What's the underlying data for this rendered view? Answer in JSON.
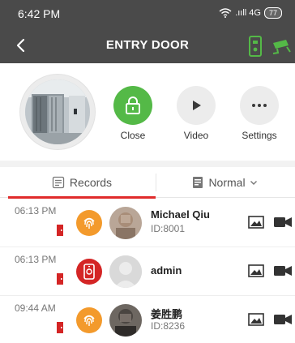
{
  "status_bar": {
    "time": "6:42 PM",
    "network": ".ııll 4G",
    "battery": "77"
  },
  "title_bar": {
    "title": "ENTRY DOOR",
    "icons": [
      "back-icon",
      "intercom-device-icon",
      "cctv-camera-icon"
    ]
  },
  "actions": [
    {
      "label": "Close",
      "icon": "lock-icon",
      "color": "#54b947"
    },
    {
      "label": "Video",
      "icon": "play-icon"
    },
    {
      "label": "Settings",
      "icon": "more-icon"
    }
  ],
  "tabs": {
    "records": "Records",
    "filter": "Normal"
  },
  "records": [
    {
      "time": "06:13 PM",
      "method": "fingerprint",
      "name": "Michael Qiu",
      "id": "ID:8001"
    },
    {
      "time": "06:13 PM",
      "method": "app",
      "name": "admin",
      "id": ""
    },
    {
      "time": "09:44 AM",
      "method": "fingerprint",
      "name": "姜胜鹏",
      "id": "ID:8236"
    }
  ],
  "colors": {
    "accent_red": "#e02b2b",
    "green": "#54b947",
    "orange": "#f39a2c",
    "bar": "#4a4a4a"
  }
}
